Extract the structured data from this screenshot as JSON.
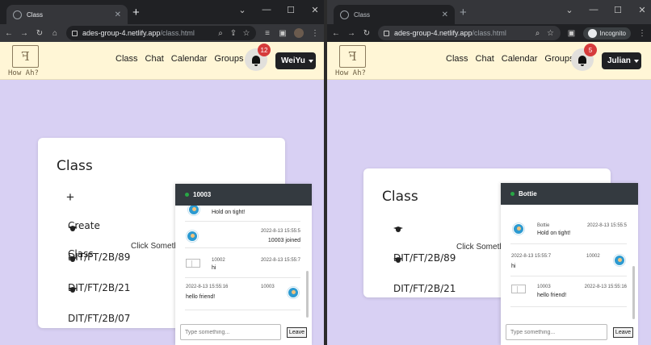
{
  "left": {
    "tab_title": "Class",
    "url_host": "ades-group-4.netlify.app",
    "url_path": "/class.html",
    "brand": "How Ah?",
    "nav": [
      "Class",
      "Chat",
      "Calendar",
      "Groups"
    ],
    "notif_count": "12",
    "user": "WeiYu",
    "card_title": "Class",
    "add_symbol": "+",
    "create_line1": "Create",
    "create_line2": "Class",
    "click_text": "Click Someth",
    "classes": [
      "DIT/FT/2B/89",
      "DIT/FT/2B/21",
      "DIT/FT/2B/07"
    ],
    "chat_title": "10003",
    "messages": [
      {
        "body": "Hold on tight!"
      },
      {
        "time": "2022-8-13 15:55:5",
        "body": "10003 joined"
      },
      {
        "sender": "10002",
        "time": "2022-8-13 15:55:7",
        "body": "hi"
      },
      {
        "time": "2022-8-13 15:55:16",
        "sender": "10003",
        "body": "hello friend!"
      }
    ],
    "input_placeholder": "Type something...",
    "leave_label": "Leave"
  },
  "right": {
    "tab_title": "Class",
    "url_host": "ades-group-4.netlify.app",
    "url_path": "/class.html",
    "incognito": "Incognito",
    "brand": "How Ah?",
    "nav": [
      "Class",
      "Chat",
      "Calendar",
      "Groups"
    ],
    "notif_count": "5",
    "user": "Julian",
    "card_title": "Class",
    "click_text": "Click Someth",
    "classes": [
      "DIT/FT/2B/89",
      "DIT/FT/2B/21"
    ],
    "chat_title": "Bottie",
    "messages": [
      {
        "sender": "Bottie",
        "time": "2022-8-13 15:55:5",
        "body": "Hold on tight!"
      },
      {
        "time": "2022-8-13 15:55:7",
        "sender": "10002",
        "body": "hi"
      },
      {
        "sender": "10003",
        "time": "2022-8-13 15:55:16",
        "body": "hello friend!"
      }
    ],
    "input_placeholder": "Type something...",
    "leave_label": "Leave"
  },
  "window_controls": [
    "⌄",
    "—",
    "☐",
    "✕"
  ]
}
